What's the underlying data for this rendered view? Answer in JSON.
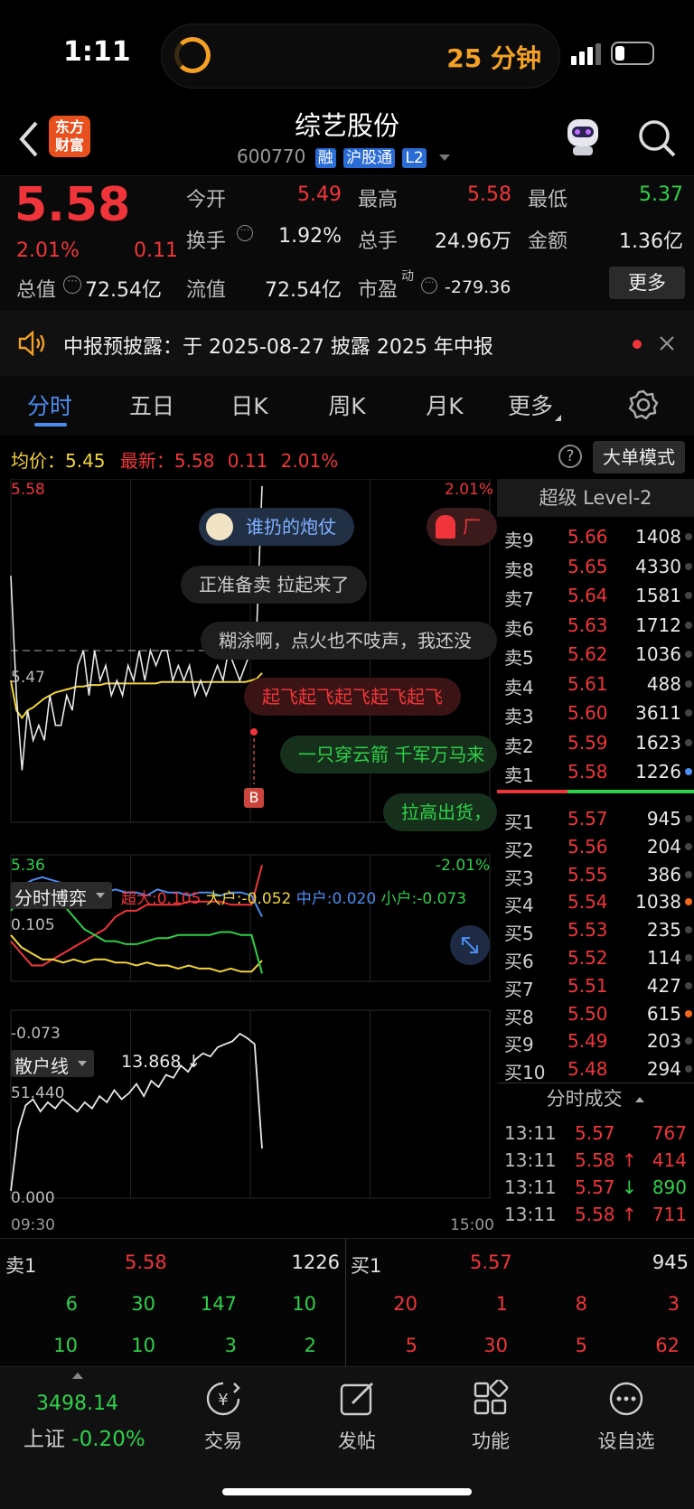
{
  "status": {
    "time": "1:11",
    "timer_label": "25 分钟"
  },
  "header": {
    "back_label": "‹",
    "logo_line1": "东方",
    "logo_line2": "财富",
    "stock_name": "综艺股份",
    "stock_code": "600770",
    "tags": [
      "融",
      "沪股通",
      "L2"
    ]
  },
  "quote": {
    "price": "5.58",
    "pct": "2.01%",
    "chg": "0.11",
    "fields": {
      "open_label": "今开",
      "open": "5.49",
      "high_label": "最高",
      "high": "5.58",
      "low_label": "最低",
      "low": "5.37",
      "turnover_label": "换手",
      "turnover": "1.92%",
      "volume_label": "总手",
      "volume": "24.96万",
      "amount_label": "金额",
      "amount": "1.36亿",
      "mktcap_label": "总值",
      "mktcap": "72.54亿",
      "float_label": "流值",
      "float": "72.54亿",
      "pe_label": "市盈",
      "pe_sup": "动",
      "pe": "-279.36"
    },
    "more_button": "更多"
  },
  "notice": {
    "text": "中报预披露：于 2025-08-27 披露 2025 年中报"
  },
  "tabs": [
    "分时",
    "五日",
    "日K",
    "周K",
    "月K",
    "更多"
  ],
  "chart_header": {
    "avg_label": "均价：",
    "avg": "5.45",
    "latest_label": "最新：",
    "latest": "5.58",
    "chg": "0.11",
    "pct": "2.01%",
    "mode_button": "大单模式"
  },
  "chart_data": [
    {
      "type": "line",
      "panel": "分时",
      "y_max_label": "5.58",
      "y_min_label": "5.36",
      "ref_label": "5.47",
      "pct_top": "2.01%",
      "pct_bottom": "-2.01%",
      "x_labels": [
        "09:30",
        "15:00"
      ],
      "series": [
        {
          "color": "#e8e8e8",
          "values": [
            5.52,
            5.44,
            5.39,
            5.43,
            5.41,
            5.42,
            5.41,
            5.44,
            5.42,
            5.42,
            5.44,
            5.43,
            5.46,
            5.47,
            5.44,
            5.47,
            5.45,
            5.46,
            5.44,
            5.45,
            5.44,
            5.46,
            5.45,
            5.47,
            5.45,
            5.47,
            5.46,
            5.47,
            5.47,
            5.45,
            5.46,
            5.45,
            5.46,
            5.44,
            5.45,
            5.44,
            5.45,
            5.46,
            5.45,
            5.47,
            5.46,
            5.45,
            5.46,
            5.47,
            5.48,
            5.58
          ]
        },
        {
          "color": "#f0d43a",
          "values": [
            5.45,
            5.43,
            5.425,
            5.43,
            5.432,
            5.435,
            5.438,
            5.44,
            5.442,
            5.443,
            5.444,
            5.445,
            5.446,
            5.446,
            5.447,
            5.447,
            5.447,
            5.448,
            5.448,
            5.448,
            5.448,
            5.448,
            5.448,
            5.448,
            5.448,
            5.448,
            5.448,
            5.449,
            5.449,
            5.449,
            5.449,
            5.449,
            5.449,
            5.449,
            5.449,
            5.449,
            5.449,
            5.449,
            5.449,
            5.449,
            5.449,
            5.449,
            5.449,
            5.45,
            5.451,
            5.455
          ]
        }
      ]
    },
    {
      "type": "line",
      "panel": "分时博弈",
      "y_max_label": "0.105",
      "y_min_label": "-0.073",
      "series": [
        {
          "name": "超大",
          "color": "#f0353a",
          "values": [
            -0.02,
            -0.04,
            -0.06,
            -0.06,
            -0.05,
            -0.04,
            -0.03,
            -0.02,
            -0.01,
            0.0,
            0.02,
            0.03,
            0.03,
            0.04,
            0.04,
            0.04,
            0.04,
            0.045,
            0.045,
            0.045,
            0.045,
            0.04,
            0.04,
            0.04,
            0.105
          ]
        },
        {
          "name": "大户",
          "color": "#f0d43a",
          "values": [
            -0.01,
            -0.03,
            -0.04,
            -0.05,
            -0.05,
            -0.055,
            -0.05,
            -0.055,
            -0.05,
            -0.05,
            -0.055,
            -0.055,
            -0.06,
            -0.055,
            -0.06,
            -0.06,
            -0.065,
            -0.06,
            -0.065,
            -0.065,
            -0.07,
            -0.065,
            -0.07,
            -0.07,
            -0.052
          ]
        },
        {
          "name": "中户",
          "color": "#4b8cf0",
          "values": [
            0.05,
            0.07,
            0.08,
            0.085,
            0.08,
            0.075,
            0.07,
            0.065,
            0.07,
            0.06,
            0.065,
            0.06,
            0.06,
            0.055,
            0.065,
            0.06,
            0.06,
            0.055,
            0.06,
            0.06,
            0.055,
            0.06,
            0.06,
            0.055,
            0.02
          ]
        },
        {
          "name": "小户",
          "color": "#2fd04a",
          "values": [
            0.03,
            0.05,
            0.07,
            0.07,
            0.06,
            0.04,
            0.02,
            0.0,
            -0.01,
            -0.02,
            -0.02,
            -0.025,
            -0.025,
            -0.02,
            -0.015,
            -0.015,
            -0.01,
            -0.01,
            -0.01,
            -0.01,
            -0.005,
            -0.005,
            -0.01,
            -0.01,
            -0.073
          ]
        }
      ]
    },
    {
      "type": "line",
      "panel": "散户线",
      "y_max_label": "51.440",
      "y_min_label": "0.000",
      "current": "13.868 ↓",
      "x_labels": [
        "09:30",
        "15:00"
      ],
      "series": [
        {
          "color": "#e8e8e8",
          "values": [
            0,
            20,
            28,
            30,
            26,
            29,
            27,
            30,
            28,
            26,
            29,
            27,
            31,
            29,
            33,
            30,
            32,
            35,
            31,
            36,
            34,
            38,
            37,
            41,
            39,
            43,
            45,
            44,
            47,
            48,
            49,
            51.44,
            50,
            48,
            13.868
          ]
        }
      ]
    }
  ],
  "gamepanel": {
    "title": "分时博弈",
    "legend": [
      {
        "label": "超大:0.105",
        "color": "#f0353a"
      },
      {
        "label": "大户:-0.052",
        "color": "#f0d43a"
      },
      {
        "label": "中户:0.020",
        "color": "#4b8cf0"
      },
      {
        "label": "小户:-0.073",
        "color": "#2fd04a"
      }
    ]
  },
  "retail": {
    "title": "散户线",
    "value": "13.868 ↓"
  },
  "danmu": [
    "谁扔的炮仗",
    "正准备卖  拉起来了",
    "糊涂啊，点火也不吱声，我还没",
    "起飞起飞起飞起飞起飞",
    "一只穿云箭 千军万马来",
    "拉高出货，",
    "厂"
  ],
  "level2": {
    "title": "超级 Level-2",
    "asks": [
      {
        "label": "卖9",
        "price": "5.66",
        "vol": "1408"
      },
      {
        "label": "卖8",
        "price": "5.65",
        "vol": "4330"
      },
      {
        "label": "卖7",
        "price": "5.64",
        "vol": "1581"
      },
      {
        "label": "卖6",
        "price": "5.63",
        "vol": "1712"
      },
      {
        "label": "卖5",
        "price": "5.62",
        "vol": "1036"
      },
      {
        "label": "卖4",
        "price": "5.61",
        "vol": "488"
      },
      {
        "label": "卖3",
        "price": "5.60",
        "vol": "3611"
      },
      {
        "label": "卖2",
        "price": "5.59",
        "vol": "1623"
      },
      {
        "label": "卖1",
        "price": "5.58",
        "vol": "1226"
      }
    ],
    "bids": [
      {
        "label": "买1",
        "price": "5.57",
        "vol": "945"
      },
      {
        "label": "买2",
        "price": "5.56",
        "vol": "204"
      },
      {
        "label": "买3",
        "price": "5.55",
        "vol": "386"
      },
      {
        "label": "买4",
        "price": "5.54",
        "vol": "1038"
      },
      {
        "label": "买5",
        "price": "5.53",
        "vol": "235"
      },
      {
        "label": "买6",
        "price": "5.52",
        "vol": "114"
      },
      {
        "label": "买7",
        "price": "5.51",
        "vol": "427"
      },
      {
        "label": "买8",
        "price": "5.50",
        "vol": "615"
      },
      {
        "label": "买9",
        "price": "5.49",
        "vol": "203"
      },
      {
        "label": "买10",
        "price": "5.48",
        "vol": "294"
      }
    ],
    "trades_title": "分时成交",
    "trades": [
      {
        "time": "13:11",
        "price": "5.57",
        "arrow": "",
        "vol": "767"
      },
      {
        "time": "13:11",
        "price": "5.58",
        "arrow": "↑",
        "vol": "414"
      },
      {
        "time": "13:11",
        "price": "5.57",
        "arrow": "↓",
        "vol": "890"
      },
      {
        "time": "13:11",
        "price": "5.58",
        "arrow": "↑",
        "vol": "711"
      }
    ]
  },
  "summary": {
    "sell_label": "卖1",
    "sell_price": "5.58",
    "sell_vol": "1226",
    "buy_label": "买1",
    "buy_price": "5.57",
    "buy_vol": "945",
    "sell_rows": [
      [
        "6",
        "30",
        "147",
        "10"
      ],
      [
        "10",
        "10",
        "3",
        "2"
      ]
    ],
    "buy_rows": [
      [
        "20",
        "1",
        "8",
        "3"
      ],
      [
        "5",
        "30",
        "5",
        "62"
      ]
    ]
  },
  "nav": {
    "index_value": "3498.14",
    "index_name": "上证",
    "index_chg": "-0.20%",
    "items": [
      "交易",
      "发帖",
      "功能",
      "设自选"
    ]
  }
}
